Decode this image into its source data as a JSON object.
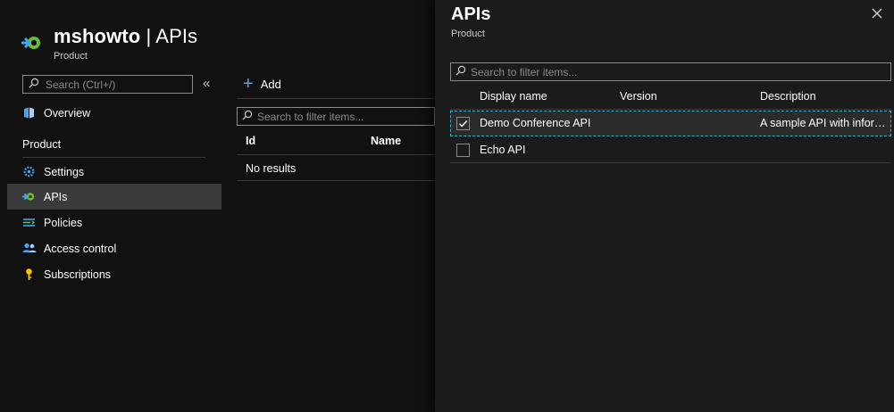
{
  "header": {
    "resource_name": "mshowto",
    "separator": " | ",
    "section": "APIs",
    "subtitle": "Product"
  },
  "sidebar": {
    "search_placeholder": "Search (Ctrl+/)",
    "collapse_glyph": "«",
    "overview_label": "Overview",
    "section_label": "Product",
    "items": [
      {
        "label": "Settings",
        "icon": "gear-icon"
      },
      {
        "label": "APIs",
        "icon": "api-icon",
        "active": true
      },
      {
        "label": "Policies",
        "icon": "policies-icon"
      },
      {
        "label": "Access control",
        "icon": "people-icon"
      },
      {
        "label": "Subscriptions",
        "icon": "key-icon"
      }
    ]
  },
  "main": {
    "add_label": "Add",
    "search_placeholder": "Search to filter items...",
    "columns": [
      "Id",
      "Name"
    ],
    "empty_text": "No results"
  },
  "blade": {
    "title": "APIs",
    "subtitle": "Product",
    "search_placeholder": "Search to filter items...",
    "columns": [
      "Display name",
      "Version",
      "Description"
    ],
    "rows": [
      {
        "display_name": "Demo Conference API",
        "version": "",
        "description": "A sample API with inform...",
        "checked": true
      },
      {
        "display_name": "Echo API",
        "version": "",
        "description": "",
        "checked": false
      }
    ]
  },
  "colors": {
    "background": "#111111",
    "blade_background": "#1b1b1b",
    "accent_blue": "#4aa3f0",
    "selection_outline": "#3ab3c9",
    "api_icon_green": "#6cbf2f"
  }
}
